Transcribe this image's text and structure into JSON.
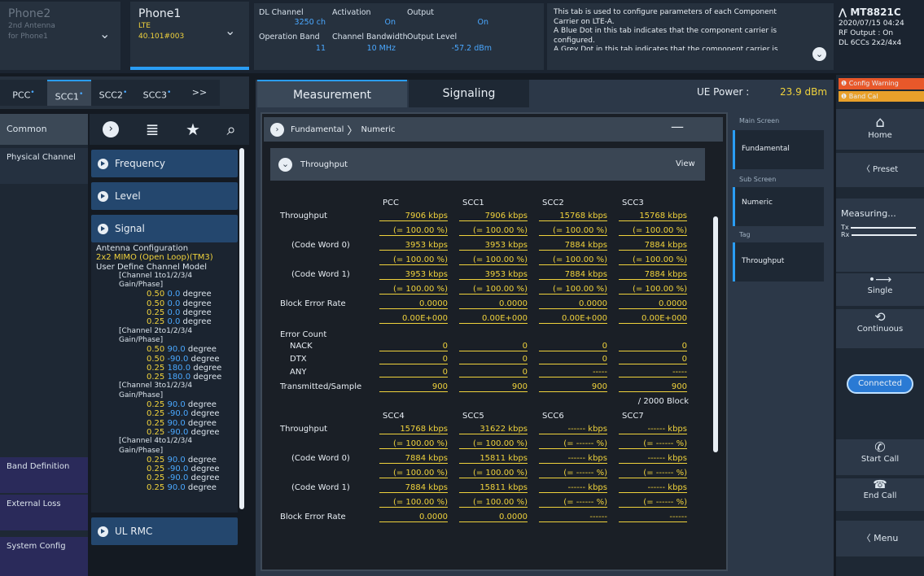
{
  "phone_tabs": [
    {
      "name": "Phone2",
      "sub1": "2nd Antenna",
      "sub2": "for Phone1"
    },
    {
      "name": "Phone1",
      "sub1": "LTE",
      "sub2": "40.101#003"
    }
  ],
  "carrier": {
    "dl_channel_label": "DL Channel",
    "dl_channel_value": "3250 ch",
    "activation_label": "Activation",
    "activation_value": "On",
    "output_label": "Output",
    "output_value": "On",
    "band_label": "Operation Band",
    "band_value": "11",
    "bw_label": "Channel Bandwidth",
    "bw_value": "10 MHz",
    "level_label": "Output Level",
    "level_value": "-57.2 dBm"
  },
  "info": {
    "line1": "This tab is used to configure parameters of each Component",
    "line2": "Carrier on LTE-A.",
    "line3": "A Blue Dot in this tab indicates that the component carrier is",
    "line4": "configured.",
    "line5": "A Grey Dot in this tab indicates that the component carrier is"
  },
  "device": {
    "model": "MT8821C",
    "date": "2020/07/15 04:24",
    "rf": "RF Output : On",
    "dl": "DL 6CCs 2x2/4x4"
  },
  "cc_tabs": [
    "PCC",
    "SCC1",
    "SCC2",
    "SCC3",
    ">>"
  ],
  "left": {
    "common": "Common",
    "physical": "Physical Channel",
    "band": "Band Definition",
    "external": "External Loss",
    "system": "System Config",
    "frequency": "Frequency",
    "level": "Level",
    "signal": "Signal",
    "ul_rmc": "UL RMC",
    "antenna_label": "Antenna Configuration",
    "antenna_value": "2x2 MIMO (Open Loop)(TM3)",
    "udcm": "User Define Channel Model",
    "ch1": "[Channel 1to1/2/3/4 Gain/Phase]",
    "ch2": "[Channel 2to1/2/3/4 Gain/Phase]",
    "ch3": "[Channel 3to1/2/3/4 Gain/Phase]",
    "ch4": "[Channel 4to1/2/3/4 Gain/Phase]",
    "g1": [
      [
        "0.50",
        "0.0",
        "degree"
      ],
      [
        "0.50",
        "0.0",
        "degree"
      ],
      [
        "0.25",
        "0.0",
        "degree"
      ],
      [
        "0.25",
        "0.0",
        "degree"
      ]
    ],
    "g2": [
      [
        "0.50",
        "90.0",
        "degree"
      ],
      [
        "0.50",
        "-90.0",
        "degree"
      ],
      [
        "0.25",
        "180.0",
        "degree"
      ],
      [
        "0.25",
        "180.0",
        "degree"
      ]
    ],
    "g3": [
      [
        "0.25",
        "90.0",
        "degree"
      ],
      [
        "0.25",
        "-90.0",
        "degree"
      ],
      [
        "0.25",
        "90.0",
        "degree"
      ],
      [
        "0.25",
        "-90.0",
        "degree"
      ]
    ],
    "g4": [
      [
        "0.25",
        "90.0",
        "degree"
      ],
      [
        "0.25",
        "-90.0",
        "degree"
      ],
      [
        "0.25",
        "-90.0",
        "degree"
      ],
      [
        "0.25",
        "90.0",
        "degree"
      ]
    ]
  },
  "main": {
    "tab_measurement": "Measurement",
    "tab_signaling": "Signaling",
    "ue_power_label": "UE Power :",
    "ue_power_value": "23.9 dBm",
    "breadcrumb_1": "Fundamental",
    "breadcrumb_2": "Numeric",
    "section": "Throughput",
    "view": "View"
  },
  "table1": {
    "headers": [
      "PCC",
      "SCC1",
      "SCC2",
      "SCC3"
    ],
    "throughput_label": "Throughput",
    "throughput": [
      "7906 kbps",
      "7906 kbps",
      "15768 kbps",
      "15768 kbps"
    ],
    "pct": [
      "(= 100.00 %)",
      "(= 100.00 %)",
      "(= 100.00 %)",
      "(= 100.00 %)"
    ],
    "cw0_label": "(Code Word 0)",
    "cw0": [
      "3953 kbps",
      "3953 kbps",
      "7884 kbps",
      "7884 kbps"
    ],
    "cw1_label": "(Code Word 1)",
    "cw1": [
      "3953 kbps",
      "3953 kbps",
      "7884 kbps",
      "7884 kbps"
    ],
    "bler_label": "Block Error Rate",
    "bler": [
      "0.0000",
      "0.0000",
      "0.0000",
      "0.0000"
    ],
    "bler_exp": [
      "0.00E+000",
      "0.00E+000",
      "0.00E+000",
      "0.00E+000"
    ],
    "err_label": "Error Count",
    "nack_label": "NACK",
    "dtx_label": "DTX",
    "any_label": "ANY",
    "nack": [
      "0",
      "0",
      "0",
      "0"
    ],
    "dtx": [
      "0",
      "0",
      "0",
      "0"
    ],
    "any": [
      "0",
      "0",
      "-----",
      "-----"
    ],
    "tx_label": "Transmitted/Sample",
    "tx": [
      "900",
      "900",
      "900",
      "900"
    ],
    "block_note": "/ 2000 Block"
  },
  "table2": {
    "headers": [
      "SCC4",
      "SCC5",
      "SCC6",
      "SCC7"
    ],
    "throughput": [
      "15768 kbps",
      "31622 kbps",
      "------ kbps",
      "------ kbps"
    ],
    "pct": [
      "(= 100.00 %)",
      "(= 100.00 %)",
      "(= ------ %)",
      "(= ------ %)"
    ],
    "cw0": [
      "7884 kbps",
      "15811 kbps",
      "------ kbps",
      "------ kbps"
    ],
    "cw1": [
      "7884 kbps",
      "15811 kbps",
      "------ kbps",
      "------ kbps"
    ],
    "bler": [
      "0.0000",
      "0.0000",
      "------",
      "------"
    ]
  },
  "screens": {
    "main_label": "Main Screen",
    "main_value": "Fundamental",
    "sub_label": "Sub Screen",
    "sub_value": "Numeric",
    "tag_label": "Tag",
    "tag_value": "Throughput"
  },
  "right": {
    "warning": "Config Warning",
    "band_cal": "Band Cal",
    "home": "Home",
    "preset": "Preset",
    "measuring": "Measuring...",
    "tx": "Tx",
    "rx": "Rx",
    "single": "Single",
    "continuous": "Continuous",
    "connected": "Connected",
    "start_call": "Start Call",
    "end_call": "End Call",
    "menu": "Menu"
  }
}
